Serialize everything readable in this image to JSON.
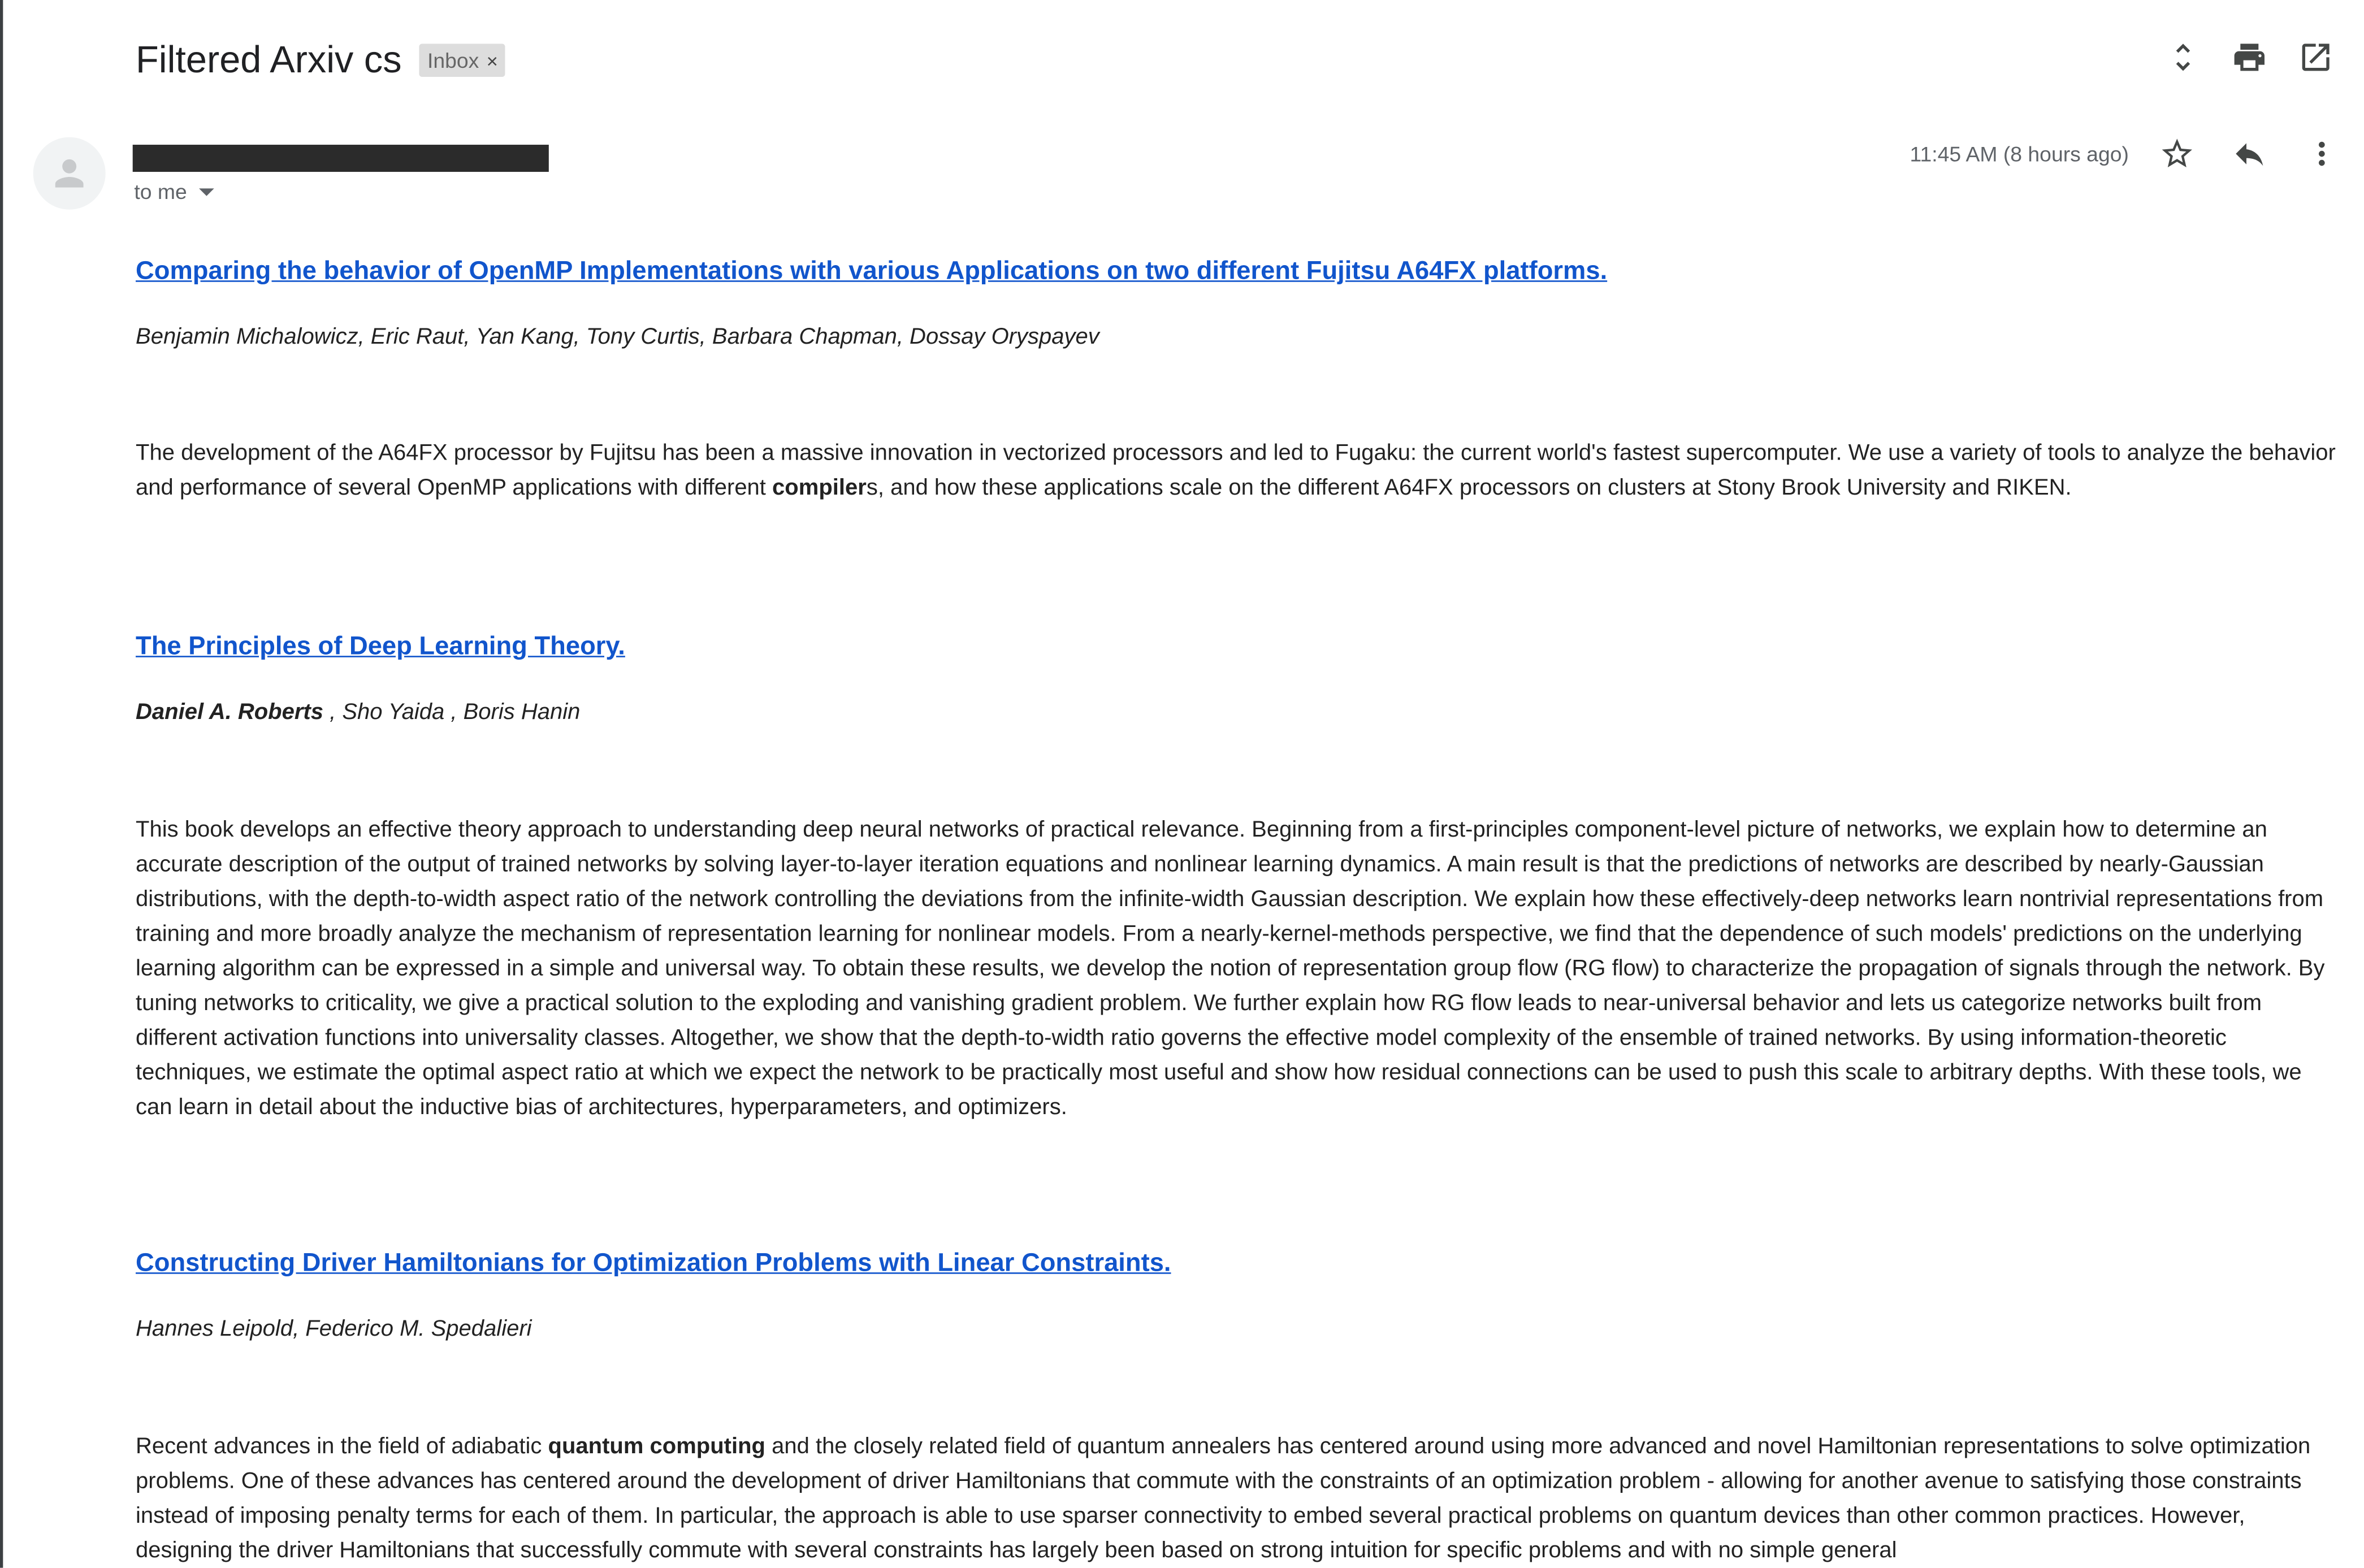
{
  "header": {
    "subject": "Filtered Arxiv cs",
    "label": "Inbox",
    "label_remove": "×",
    "icons": [
      "expand-collapse-icon",
      "print-icon",
      "open-new-window-icon"
    ]
  },
  "message": {
    "to": "to me",
    "timestamp": "11:45 AM (8 hours ago)",
    "icons": [
      "star-icon",
      "reply-icon",
      "more-vertical-icon"
    ]
  },
  "papers": [
    {
      "title": "Comparing the behavior of OpenMP Implementations with various Applications on two different Fujitsu A64FX platforms.",
      "authors": "Benjamin Michalowicz, Eric Raut, Yan Kang, Tony Curtis, Barbara Chapman, Dossay Oryspayev",
      "abstract_parts": [
        "The development of the A64FX processor by Fujitsu has been a massive innovation in vectorized processors and led to Fugaku: the current world's fastest supercomputer. We use a variety of tools to analyze the behavior and performance of several OpenMP applications with different ",
        "compiler",
        "s, and how these applications scale on the different A64FX processors on clusters at Stony Brook University and RIKEN."
      ]
    },
    {
      "title": "The Principles of Deep Learning Theory.",
      "authors_bold": "Daniel A. Roberts",
      "authors_rest": " , Sho Yaida , Boris Hanin",
      "abstract": "This book develops an effective theory approach to understanding deep neural networks of practical relevance. Beginning from a first-principles component-level picture of networks, we explain how to determine an accurate description of the output of trained networks by solving layer-to-layer iteration equations and nonlinear learning dynamics. A main result is that the predictions of networks are described by nearly-Gaussian distributions, with the depth-to-width aspect ratio of the network controlling the deviations from the infinite-width Gaussian description. We explain how these effectively-deep networks learn nontrivial representations from training and more broadly analyze the mechanism of representation learning for nonlinear models. From a nearly-kernel-methods perspective, we find that the dependence of such models' predictions on the underlying learning algorithm can be expressed in a simple and universal way. To obtain these results, we develop the notion of representation group flow (RG flow) to characterize the propagation of signals through the network. By tuning networks to criticality, we give a practical solution to the exploding and vanishing gradient problem. We further explain how RG flow leads to near-universal behavior and lets us categorize networks built from different activation functions into universality classes. Altogether, we show that the depth-to-width ratio governs the effective model complexity of the ensemble of trained networks. By using information-theoretic techniques, we estimate the optimal aspect ratio at which we expect the network to be practically most useful and show how residual connections can be used to push this scale to arbitrary depths. With these tools, we can learn in detail about the inductive bias of architectures, hyperparameters, and optimizers."
    },
    {
      "title": "Constructing Driver Hamiltonians for Optimization Problems with Linear Constraints.",
      "authors": "Hannes Leipold, Federico M. Spedalieri",
      "abstract_parts": [
        "Recent advances in the field of adiabatic ",
        "quantum computing",
        " and the closely related field of quantum annealers has centered around using more advanced and novel Hamiltonian representations to solve optimization problems. One of these advances has centered around the development of driver Hamiltonians that commute with the constraints of an optimization problem - allowing for another avenue to satisfying those constraints instead of imposing penalty terms for each of them. In particular, the approach is able to use sparser connectivity to embed several practical problems on quantum devices than other common practices. However, designing the driver Hamiltonians that successfully commute with several constraints has largely been based on strong intuition for specific problems and with no simple general"
      ]
    }
  ]
}
